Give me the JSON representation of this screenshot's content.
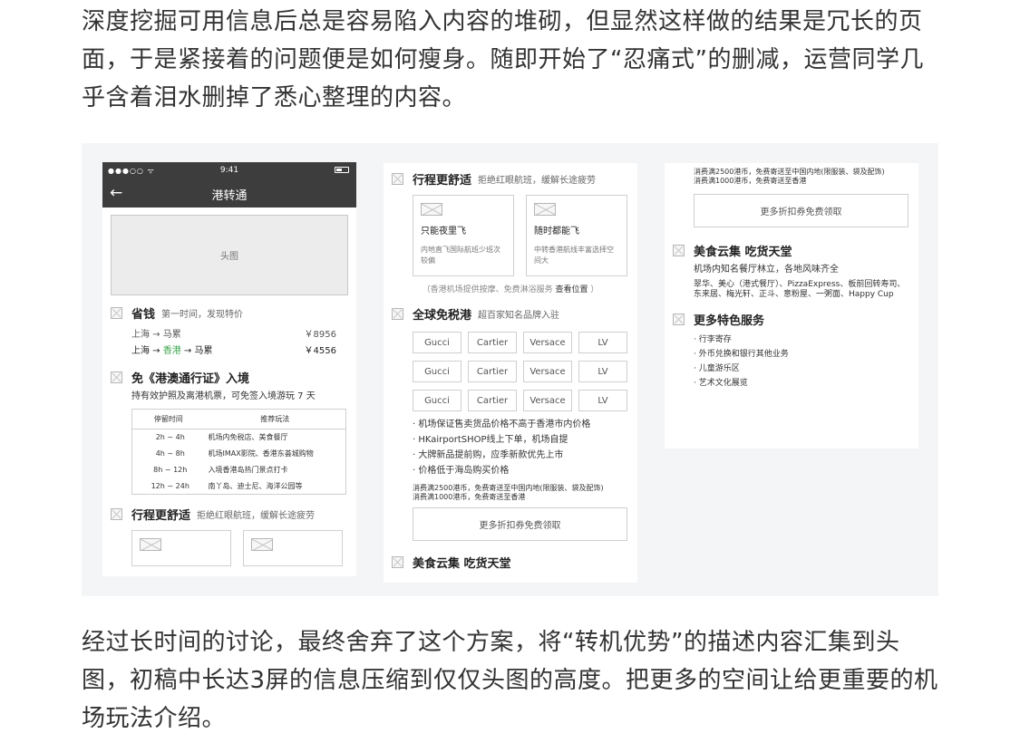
{
  "article": {
    "para_top": "深度挖掘可用信息后总是容易陷入内容的堆砌，但显然这样做的结果是冗长的页面，于是紧接着的问题便是如何瘦身。随即开始了“忍痛式”的删减，运营同学几乎含着泪水删掉了悉心整理的内容。",
    "para_bottom": "经过长时间的讨论，最终舍弃了这个方案，将“转机优势”的描述内容汇集到头图，初稿中长达3屏的信息压缩到仅仅头图的高度。把更多的空间让给更重要的机场玩法介绍。"
  },
  "phone": {
    "signal": "●●●○○ ᯤ",
    "time": "9:41",
    "title": "港转通",
    "back_icon": "←",
    "hero_label": "头图"
  },
  "save": {
    "title": "省钱",
    "subtitle": "第一时间，发现特价",
    "r1_from": "上海 → 马累",
    "r1_price": "￥8956",
    "r2_a": "上海 → ",
    "r2_mid": "香港",
    "r2_b": " → 马累",
    "r2_price": "￥4556",
    "color_highlight": "#3ca54e"
  },
  "visa": {
    "title": "免《港澳通行证》入境",
    "desc": "持有效护照及离港机票，可免签入境游玩 7 天",
    "head_time": "停留时间",
    "head_play": "推荐玩法",
    "rows": [
      {
        "time": "2h ~ 4h",
        "play": "机场内免税店、美食餐厅"
      },
      {
        "time": "4h ~ 8h",
        "play": "机场IMAX影院、香港东荟城购物"
      },
      {
        "time": "8h ~ 12h",
        "play": "入境香港岛热门景点打卡"
      },
      {
        "time": "12h ~ 24h",
        "play": "南丫岛、迪士尼、海洋公园等"
      }
    ]
  },
  "comfort": {
    "title": "行程更舒适",
    "subtitle": "拒绝红眼航班，缓解长途疲劳",
    "box1_title": "只能夜里飞",
    "box1_desc": "内地直飞国际航班少班次较偏",
    "box2_title": "随时都能飞",
    "box2_desc": "中转香港航线丰富选择空间大",
    "note": "（香港机场提供按摩、免费淋浴服务",
    "note_link": "查看位置",
    "note_end": "）"
  },
  "dutyfree": {
    "title": "全球免税港",
    "subtitle": "超百家知名品牌入驻",
    "brands": [
      "Gucci",
      "Cartier",
      "Versace",
      "LV",
      "Gucci",
      "Cartier",
      "Versace",
      "LV",
      "Gucci",
      "Cartier",
      "Versace",
      "LV"
    ],
    "bullets": [
      "· 机场保证售卖货品价格不高于香港市内价格",
      "· HKairportSHOP线上下单，机场自提",
      "· 大牌新品提前购，应季新款优先上市",
      "· 价格低于海岛购买价格"
    ],
    "fine1": "消费满2500港币，免费寄送至中国内地(限服装、袋及配饰)",
    "fine2": "消费满1000港币，免费寄送至香港",
    "button": "更多折扣券免费领取"
  },
  "food": {
    "title": "美食云集 吃货天堂",
    "desc": "机场内知名餐厅林立，各地风味齐全",
    "list": "翠华、美心（港式餐厅）、PizzaExpress、板前回转寿司、东来居、梅光轩、正斗、意粉屋、一粥面、Happy Cup"
  },
  "more": {
    "title": "更多特色服务",
    "items": [
      "· 行李寄存",
      "· 外币兑换和银行其他业务",
      "· 儿童游乐区",
      "· 艺术文化展览"
    ]
  }
}
